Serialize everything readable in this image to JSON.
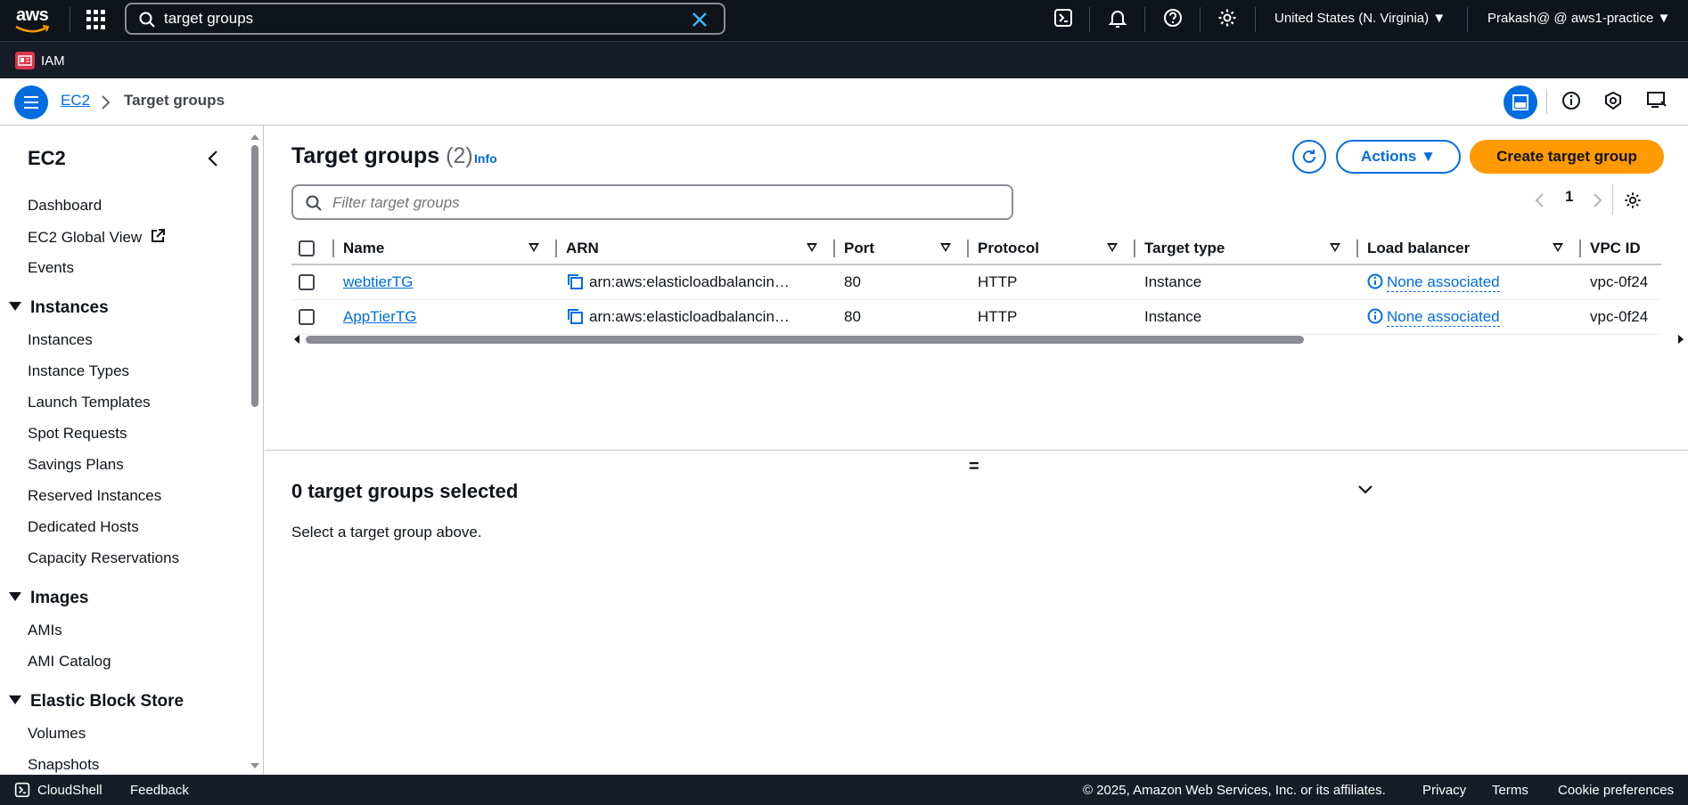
{
  "topbar": {
    "logo_text": "aws",
    "search_value": "target groups",
    "region": "United States (N. Virginia)",
    "account": "Prakash@ @ aws1-practice"
  },
  "subbar": {
    "service_label": "IAM"
  },
  "breadcrumb": {
    "parent": "EC2",
    "current": "Target groups"
  },
  "sidebar": {
    "title": "EC2",
    "items_top": [
      "Dashboard",
      "EC2 Global View",
      "Events"
    ],
    "instances_section": "Instances",
    "instances_items": [
      "Instances",
      "Instance Types",
      "Launch Templates",
      "Spot Requests",
      "Savings Plans",
      "Reserved Instances",
      "Dedicated Hosts",
      "Capacity Reservations"
    ],
    "images_section": "Images",
    "images_items": [
      "AMIs",
      "AMI Catalog"
    ],
    "ebs_section": "Elastic Block Store",
    "ebs_items": [
      "Volumes",
      "Snapshots"
    ]
  },
  "main": {
    "title": "Target groups",
    "count": "(2)",
    "info": "Info",
    "actions_label": "Actions",
    "create_label": "Create target group",
    "filter_placeholder": "Filter target groups",
    "page_number": "1",
    "columns": [
      "Name",
      "ARN",
      "Port",
      "Protocol",
      "Target type",
      "Load balancer",
      "VPC ID"
    ],
    "rows": [
      {
        "name": "webtierTG",
        "arn": "arn:aws:elasticloadbalancin…",
        "port": "80",
        "protocol": "HTTP",
        "target_type": "Instance",
        "load_balancer": "None associated",
        "vpc": "vpc-0f24"
      },
      {
        "name": "AppTierTG",
        "arn": "arn:aws:elasticloadbalancin…",
        "port": "80",
        "protocol": "HTTP",
        "target_type": "Instance",
        "load_balancer": "None associated",
        "vpc": "vpc-0f24"
      }
    ],
    "split_handle": "=",
    "selected_title": "0 target groups selected",
    "selected_text": "Select a target group above."
  },
  "footer": {
    "cloudshell": "CloudShell",
    "feedback": "Feedback",
    "copyright": "© 2025, Amazon Web Services, Inc. or its affiliates.",
    "privacy": "Privacy",
    "terms": "Terms",
    "cookies": "Cookie preferences"
  },
  "colors": {
    "accent": "#006ce0",
    "primary_button": "#ff9900",
    "topbar": "#0f141a"
  }
}
